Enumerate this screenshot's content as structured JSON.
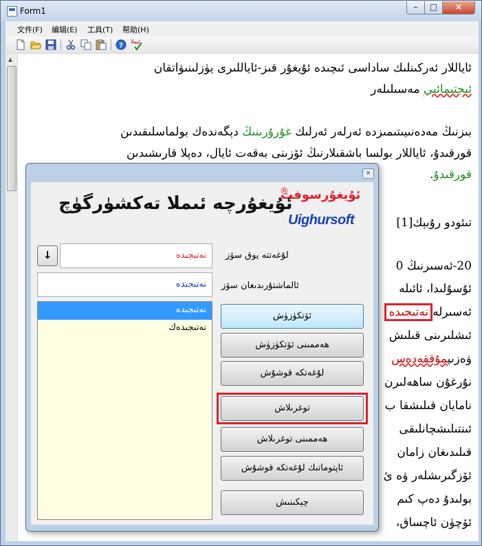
{
  "window": {
    "title": "Form1"
  },
  "menu": [
    "文件(F)",
    "编辑(E)",
    "工具(T)",
    "帮助(H)"
  ],
  "toolbar": [
    "new-icon",
    "open-icon",
    "save-icon",
    "cut-icon",
    "copy-icon",
    "paste-icon",
    "help-icon",
    "spellcheck-icon"
  ],
  "toolbar_spell_text": "ئېملا",
  "document": {
    "p1a": "ئاياللار ئەركىنلىك ساداسى ئىچىدە ئۇيغۇر قىز-ئاياللىرى يۈزلىنىۋاتقان",
    "p1b_green": "ئىجتىمائىي",
    "p1b_rest": " مەسىلىلەر",
    "p2a_pre": "بىزنىڭ مەدەنىيىتىمىزدە ئەرلەر ئەرلىك ",
    "p2a_green": "غۇرۇرىنىڭ",
    "p2a_post": " دېگەندەك بولماسلىقىدىن",
    "p2b": "قورقىدۇ، ئاياللار بولسا باشقىلارنىڭ ئۆزىنى بەقەت ئايال، دەپلا قارىشىدىن",
    "p2c_green": "قورقىدۇ",
    "p2c_rest": ".",
    "p3": "تىئودو رۇبېك[1]",
    "p4": "20-ئەسىرنىڭ 0",
    "p5": "ئۇسۇلىدا، ئائىلە",
    "p6_pre": "ئەسىرلە",
    "p6_box": "نەتىجىدە",
    "p7": "ئىشلىرىنى قىلىش",
    "p8_pre": "ۋەزىپ",
    "p8_mark": "مۇققەدەس",
    "p9": "نۇرغۇن ساھەلىرن",
    "p10": "نامايان قىلىشقا ب",
    "p11": "ئىنتىلىشچانلىقى",
    "p12": "قىلىدىغان زامان",
    "p13": "ئۆزگىرىشلەر ۋە ئ",
    "p14": "بولىدۇ دەپ كىم",
    "p15": "ئۆچۈن ئاچساق،"
  },
  "dialog": {
    "brand_uyghur": "ئۇيغۇرسوفت",
    "brand_reg": "®",
    "brand_latin": "Uighursoft",
    "title": "ئۇيغۇرچە ئىملا تەكشۈرگۈچ",
    "label_not_in_dict": "لۇغەتتە يوق سۆز",
    "label_replacement": "ئالماشتۇرىدىغان سۆز",
    "field_not_in_dict": "نەتىجىدە",
    "field_replacement": "نەتىجىدە",
    "arrow_glyph": "↓",
    "suggestions": [
      "نەتىجىدە",
      "نەتىجىدەك"
    ],
    "buttons": {
      "ignore": "ئۆتكۈزۈش",
      "ignore_all": "ھەممىنى ئۆتكۈزۈش",
      "add_dict": "لۇغەتكە قوشۇش",
      "change": "توغرىلاش",
      "change_all": "ھەممىنى توغرىلاش",
      "autocorrect": "ئاپتوماتىك لۇغەتكە قوشۇش",
      "close": "چېكىنىش"
    },
    "close_glyph": "×"
  },
  "colors": {
    "highlight": "#e0202c",
    "brand_blue": "#1440b8",
    "list_selected": "#3399ff",
    "list_bg": "#ffffe1"
  }
}
